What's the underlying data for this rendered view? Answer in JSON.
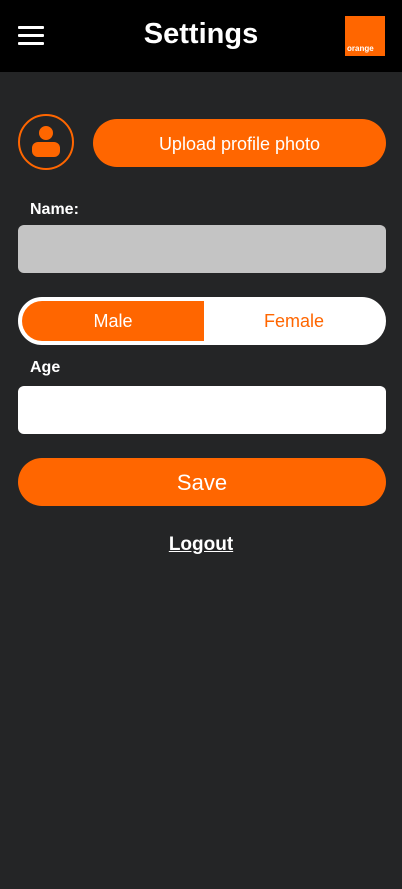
{
  "header": {
    "title": "Settings",
    "menu_icon": "hamburger-menu-icon",
    "logo_text": "orange"
  },
  "profile": {
    "avatar_icon": "user-avatar-icon",
    "upload_label": "Upload profile photo"
  },
  "form": {
    "name_label": "Name:",
    "name_value": "",
    "gender_options": [
      "Male",
      "Female"
    ],
    "gender_selected": "Male",
    "age_label": "Age",
    "age_value": "",
    "save_label": "Save"
  },
  "footer": {
    "logout_label": "Logout"
  },
  "colors": {
    "accent": "#ff6600",
    "background": "#242526",
    "header_bg": "#000000",
    "name_field_bg": "#c4c4c4"
  }
}
